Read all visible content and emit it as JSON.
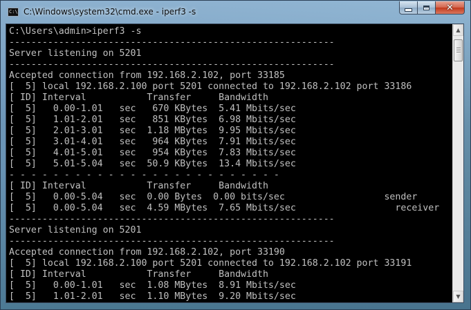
{
  "window": {
    "title": "C:\\Windows\\system32\\cmd.exe - iperf3  -s",
    "icon_name": "cmd-window-icon",
    "icon_text": "C:\\"
  },
  "caption_buttons": {
    "minimize_icon": "minimize-icon",
    "maximize_icon": "maximize-icon",
    "close_icon": "close-icon",
    "close_glyph": "✕"
  },
  "scrollbar": {
    "up_arrow": "▲",
    "down_arrow": "▼"
  },
  "console": {
    "lines": [
      "C:\\Users\\admin>iperf3 -s",
      "-----------------------------------------------------------",
      "Server listening on 5201",
      "-----------------------------------------------------------",
      "Accepted connection from 192.168.2.102, port 33185",
      "[  5] local 192.168.2.100 port 5201 connected to 192.168.2.102 port 33186",
      "[ ID] Interval           Transfer     Bandwidth",
      "[  5]   0.00-1.01   sec   670 KBytes  5.41 Mbits/sec",
      "[  5]   1.01-2.01   sec   851 KBytes  6.98 Mbits/sec",
      "[  5]   2.01-3.01   sec  1.18 MBytes  9.95 Mbits/sec",
      "[  5]   3.01-4.01   sec   964 KBytes  7.91 Mbits/sec",
      "[  5]   4.01-5.01   sec   954 KBytes  7.83 Mbits/sec",
      "[  5]   5.01-5.04   sec  50.9 KBytes  13.4 Mbits/sec",
      "- - - - - - - - - - - - - - - - - - - - - - - - -",
      "[ ID] Interval           Transfer     Bandwidth",
      "[  5]   0.00-5.04   sec  0.00 Bytes  0.00 bits/sec                  sender",
      "[  5]   0.00-5.04   sec  4.59 MBytes  7.65 Mbits/sec                  receiver",
      "-----------------------------------------------------------",
      "Server listening on 5201",
      "-----------------------------------------------------------",
      "Accepted connection from 192.168.2.102, port 33190",
      "[  5] local 192.168.2.100 port 5201 connected to 192.168.2.102 port 33191",
      "[ ID] Interval           Transfer     Bandwidth",
      "[  5]   0.00-1.01   sec  1.08 MBytes  8.91 Mbits/sec",
      "[  5]   1.01-2.01   sec  1.10 MBytes  9.20 Mbits/sec"
    ]
  }
}
